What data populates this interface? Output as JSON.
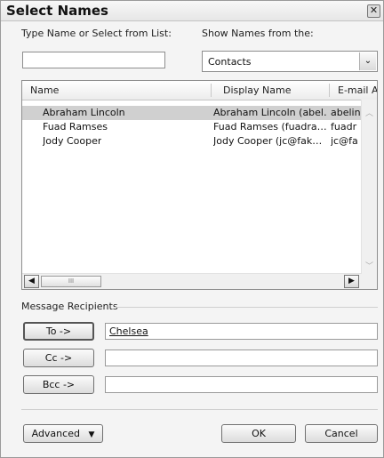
{
  "window": {
    "title": "Select Names",
    "close_glyph": "✕"
  },
  "search": {
    "label": "Type Name or Select from List:",
    "label_access_key": "y",
    "value": ""
  },
  "address_book": {
    "label": "Show Names from the:",
    "label_access_key": "S",
    "selected": "Contacts",
    "arrow_glyph": "⌄"
  },
  "list": {
    "columns": [
      "Name",
      "Display Name",
      "E-mail A"
    ],
    "rows": [
      {
        "name": "Abraham Lincoln",
        "display": "Abraham Lincoln (abel…",
        "email": "abelin",
        "selected": true
      },
      {
        "name": "Fuad Ramses",
        "display": "Fuad Ramses (fuadra…",
        "email": "fuadr",
        "selected": false
      },
      {
        "name": "Jody Cooper",
        "display": "Jody Cooper (jc@fak…",
        "email": "jc@fa",
        "selected": false
      }
    ],
    "scroll_left_glyph": "◀",
    "scroll_right_glyph": "▶",
    "thumb_grip": "III"
  },
  "recipients": {
    "group_label": "Message Recipients",
    "to_button": "To ->",
    "to_value": "Chelsea",
    "cc_button": "Cc ->",
    "cc_value": "",
    "bcc_button": "Bcc ->",
    "bcc_value": ""
  },
  "footer": {
    "advanced_label": "Advanced",
    "advanced_arrow": "▼",
    "ok_label": "OK",
    "cancel_label": "Cancel"
  }
}
